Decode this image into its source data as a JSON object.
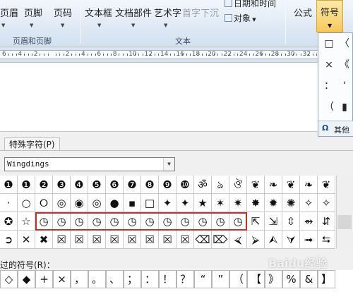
{
  "ribbon": {
    "buttons": {
      "header": "页眉",
      "footer": "页脚",
      "page_number": "页码",
      "textbox": "文本框",
      "quick_parts": "文档部件",
      "wordart": "艺术字",
      "dropcap": "首字下沉",
      "datetime": "日期和时间",
      "object": "对象",
      "equation": "公式",
      "symbol": "符号"
    },
    "groups": {
      "header_footer": "页眉和页脚",
      "text": "文本"
    },
    "symbol_button_state": "pressed"
  },
  "ruler": {
    "numbers": [
      "6",
      "4",
      "2",
      "",
      "2",
      "4",
      "6",
      "8",
      "10",
      "12",
      "14",
      "16",
      "18",
      "20",
      "22",
      "24",
      "26",
      "28",
      "30",
      "32"
    ]
  },
  "symbol_dropdown": {
    "symbols": [
      "□",
      "〈",
      "×",
      "《",
      "：",
      "‘",
      "（",
      "▮"
    ],
    "more_label": "其他"
  },
  "dialog": {
    "tab_label": "特殊字符(P)",
    "font_value": "Wingdings",
    "recent_label": "近期使用过的符号(R)：",
    "recent_label_visible": "过的符号(R)：",
    "recent_symbols": [
      "◇",
      "◆",
      "+",
      "×",
      "，",
      "。",
      "、",
      "；",
      "：",
      "！",
      "？",
      "“",
      "”",
      "（",
      "【",
      "》",
      "%",
      "&",
      "】"
    ]
  },
  "symbol_grid": {
    "rows": [
      [
        "❶",
        "❶",
        "❷",
        "❸",
        "❹",
        "❺",
        "❻",
        "❼",
        "❽",
        "❾",
        "❿",
        "ॐ",
        "ঌ",
        "ঔ",
        "❦",
        "❧",
        "❦",
        "❧",
        "❦"
      ],
      [
        "·",
        "○",
        "⭘",
        "◎",
        "◉",
        "◎",
        "●",
        "▪",
        "□",
        "✦",
        "✦",
        "★",
        "✶",
        "✷",
        "✸",
        "✹",
        "✺",
        "✧",
        "✧"
      ],
      [
        "✪",
        "☆",
        "◷",
        "◷",
        "◷",
        "◷",
        "◷",
        "◷",
        "◷",
        "◷",
        "◷",
        "◷",
        "◷",
        "◷",
        "⇱",
        "⇲",
        "⇳",
        "⇴",
        "⇵"
      ],
      [
        "➲",
        "✕",
        "✖",
        "☒",
        "☒",
        "☒",
        "☒",
        "☒",
        "☒",
        "☒",
        "☒",
        "⌫",
        "⌦",
        "⮘",
        "⮚",
        "⮙",
        "⮛",
        "➟",
        "⮀"
      ]
    ]
  },
  "watermark": "Baidu经验"
}
